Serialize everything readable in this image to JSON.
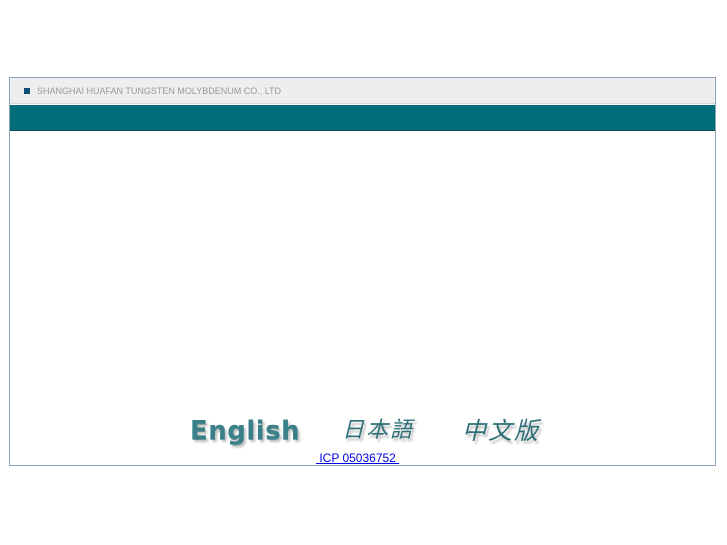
{
  "header": {
    "company_name": "SHANGHAI HUAFAN TUNGSTEN MOLYBDENUM CO., LTD"
  },
  "languages": [
    {
      "label": "English"
    },
    {
      "label": "日本語"
    },
    {
      "label": "中文版"
    }
  ],
  "footer": {
    "icp_link": " ICP 05036752 "
  },
  "colors": {
    "banner": "#006d7a",
    "header_bar": "#eeeeee",
    "frame_border": "#8ea3b8",
    "language_text": "#3a8088",
    "link": "#0000ee"
  }
}
